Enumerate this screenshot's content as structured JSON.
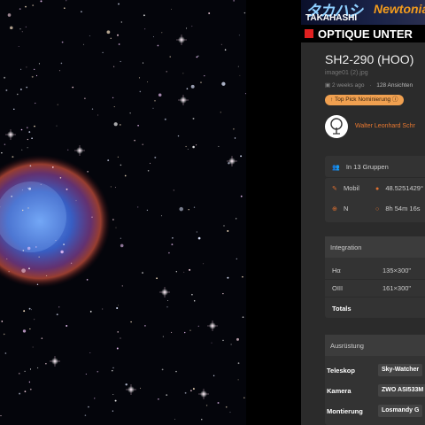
{
  "ads": {
    "top_banner": {
      "japanese": "タカハシ",
      "brand": "TAKAHASHI",
      "product": "Newtonia"
    },
    "second_banner": {
      "text": "OPTIQUE UNTER"
    }
  },
  "image": {
    "title": "SH2-290 (HOO)",
    "filename": "image01 (2).jpg",
    "posted": "2 weeks ago",
    "views": "128 Ansichten",
    "badge": "Top Pick Nominierung",
    "author": "Walter Leonhard Schr"
  },
  "details": {
    "groups": "In 13 Gruppen",
    "device": "Mobil",
    "location": "48.5251429°",
    "direction": "N",
    "ra": "8h 54m 16s"
  },
  "integration": {
    "header": "Integration",
    "rows": [
      {
        "filter": "Hα",
        "value": "135×300\""
      },
      {
        "filter": "OIII",
        "value": "161×300\""
      }
    ],
    "totals_label": "Totals"
  },
  "equipment": {
    "header": "Ausrüstung",
    "items": [
      {
        "label": "Teleskop",
        "value": "Sky-Watcher"
      },
      {
        "label": "Kamera",
        "value": "ZWO ASI533M"
      },
      {
        "label": "Montierung",
        "value": "Losmandy G"
      }
    ]
  },
  "colors": {
    "accent": "#e87830",
    "panel": "#2b2b2b",
    "badge": "#f0a050"
  }
}
